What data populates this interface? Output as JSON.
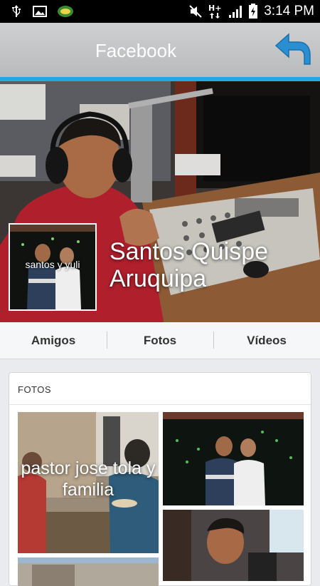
{
  "status_bar": {
    "time": "3:14 PM",
    "left_icons": [
      "usb-icon",
      "image-icon",
      "app-logo-icon"
    ],
    "right_icons": [
      "mute-icon",
      "hplus-network-icon",
      "signal-icon",
      "battery-charging-icon"
    ]
  },
  "app_bar": {
    "title": "Facebook",
    "back_icon": "back-arrow-icon"
  },
  "colors": {
    "accent": "#22a9e4",
    "status_bar": "#000000",
    "app_bar": "#c4c5c7"
  },
  "profile": {
    "name": "Santos Quispe Aruquipa",
    "avatar_caption": "santos y yuli"
  },
  "tabs": [
    {
      "label": "Amigos"
    },
    {
      "label": "Fotos"
    },
    {
      "label": "Vídeos"
    }
  ],
  "photos_section": {
    "title": "FOTOS",
    "items": [
      {
        "caption": "pastor jose tola y familia"
      },
      {
        "caption": ""
      },
      {
        "caption": ""
      },
      {
        "caption": ""
      }
    ]
  }
}
